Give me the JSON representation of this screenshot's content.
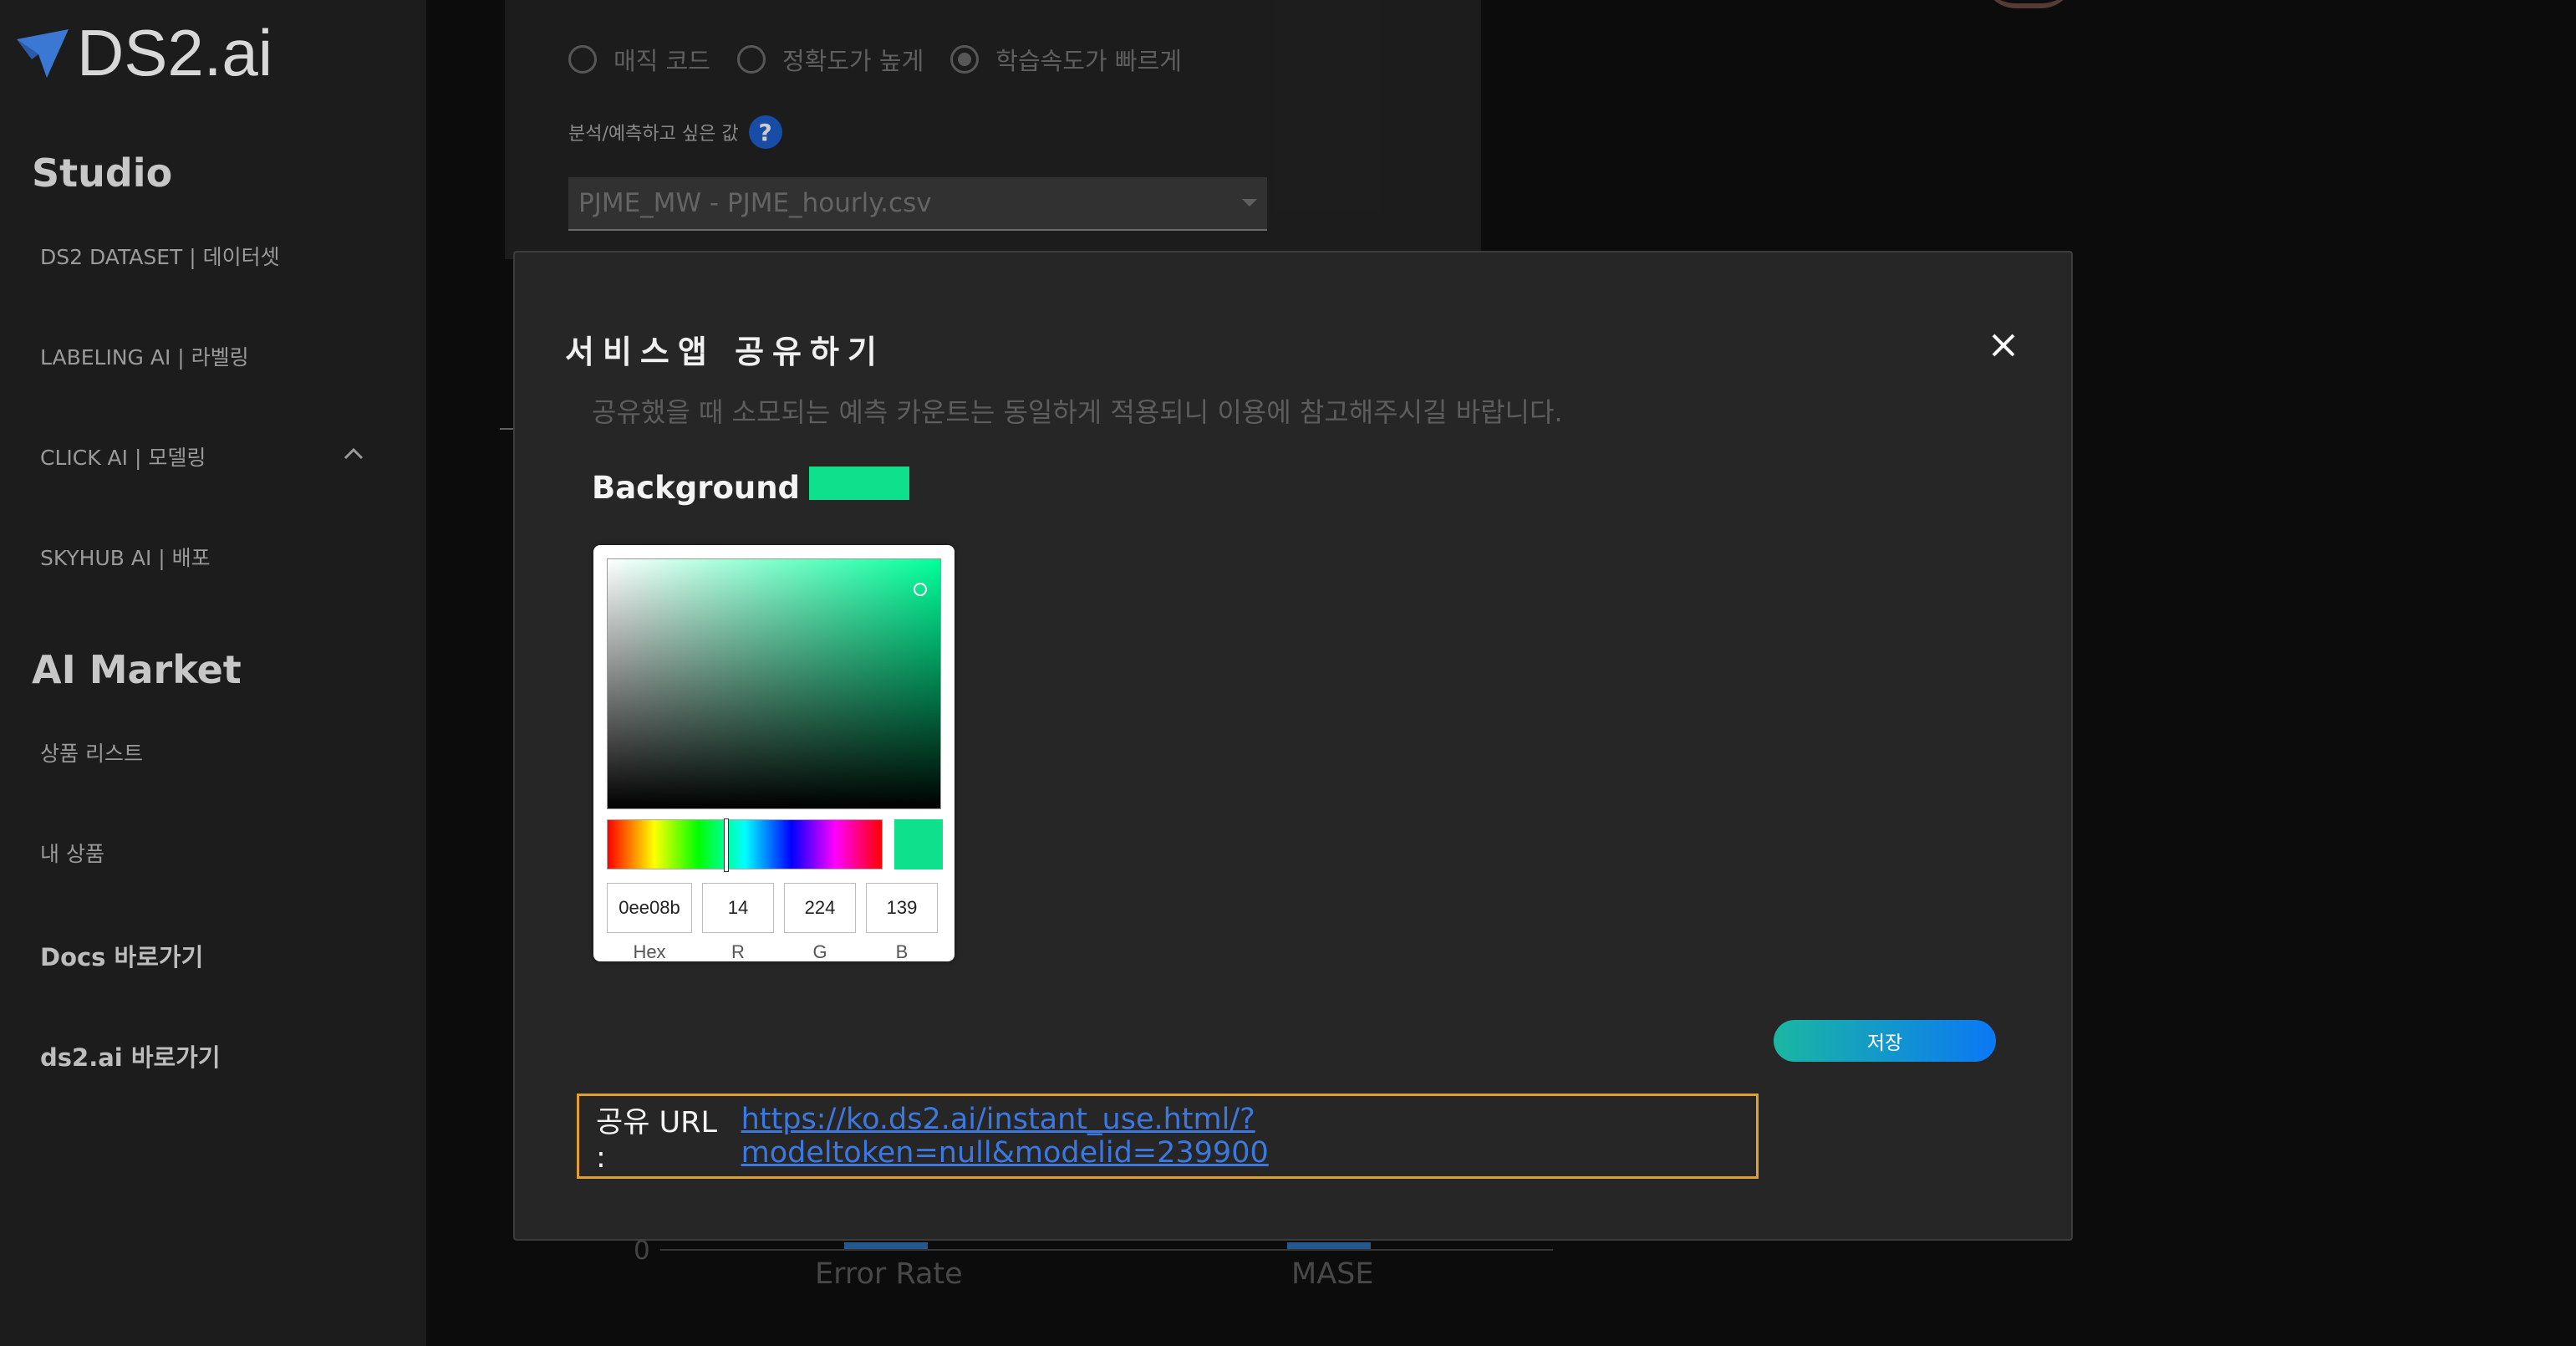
{
  "app": {
    "logo_text": "DS2.ai"
  },
  "sidebar": {
    "studio_title": "Studio",
    "studio_items": [
      {
        "label": "DS2 DATASET | 데이터셋"
      },
      {
        "label": "LABELING AI | 라벨링"
      },
      {
        "label": "CLICK AI | 모델링"
      },
      {
        "label": "SKYHUB AI | 배포"
      }
    ],
    "market_title": "AI Market",
    "market_items": [
      {
        "label": "상품 리스트"
      },
      {
        "label": "내 상품"
      }
    ],
    "links": [
      {
        "label": "Docs 바로가기"
      },
      {
        "label": "ds2.ai 바로가기"
      }
    ]
  },
  "background": {
    "radios": [
      {
        "label": "매직 코드",
        "selected": false
      },
      {
        "label": "정확도가 높게",
        "selected": false
      },
      {
        "label": "학습속도가 빠르게",
        "selected": true
      }
    ],
    "target_label": "분석/예측하고 싶은 값",
    "help_icon": "?",
    "target_select": "PJME_MW - PJME_hourly.csv",
    "chart": {
      "zero_tick": "0",
      "x_labels": [
        "Error Rate",
        "MASE"
      ]
    }
  },
  "modal": {
    "title": "서비스앱 공유하기",
    "notice": "공유했을 때 소모되는 예측 카운트는 동일하게 적용되니 이용에 참고해주시길 바랍니다.",
    "background_label": "Background :",
    "color": "#0ee08b",
    "picker": {
      "hex": "0ee08b",
      "r": "14",
      "g": "224",
      "b": "139",
      "hue_deg": 156,
      "saturation": 0.94,
      "brightness": 0.88,
      "labels": {
        "hex": "Hex",
        "r": "R",
        "g": "G",
        "b": "B"
      }
    },
    "save_label": "저장",
    "share_prefix": "공유 URL :",
    "share_url": "https://ko.ds2.ai/instant_use.html/?modeltoken=null&modelid=239900"
  }
}
